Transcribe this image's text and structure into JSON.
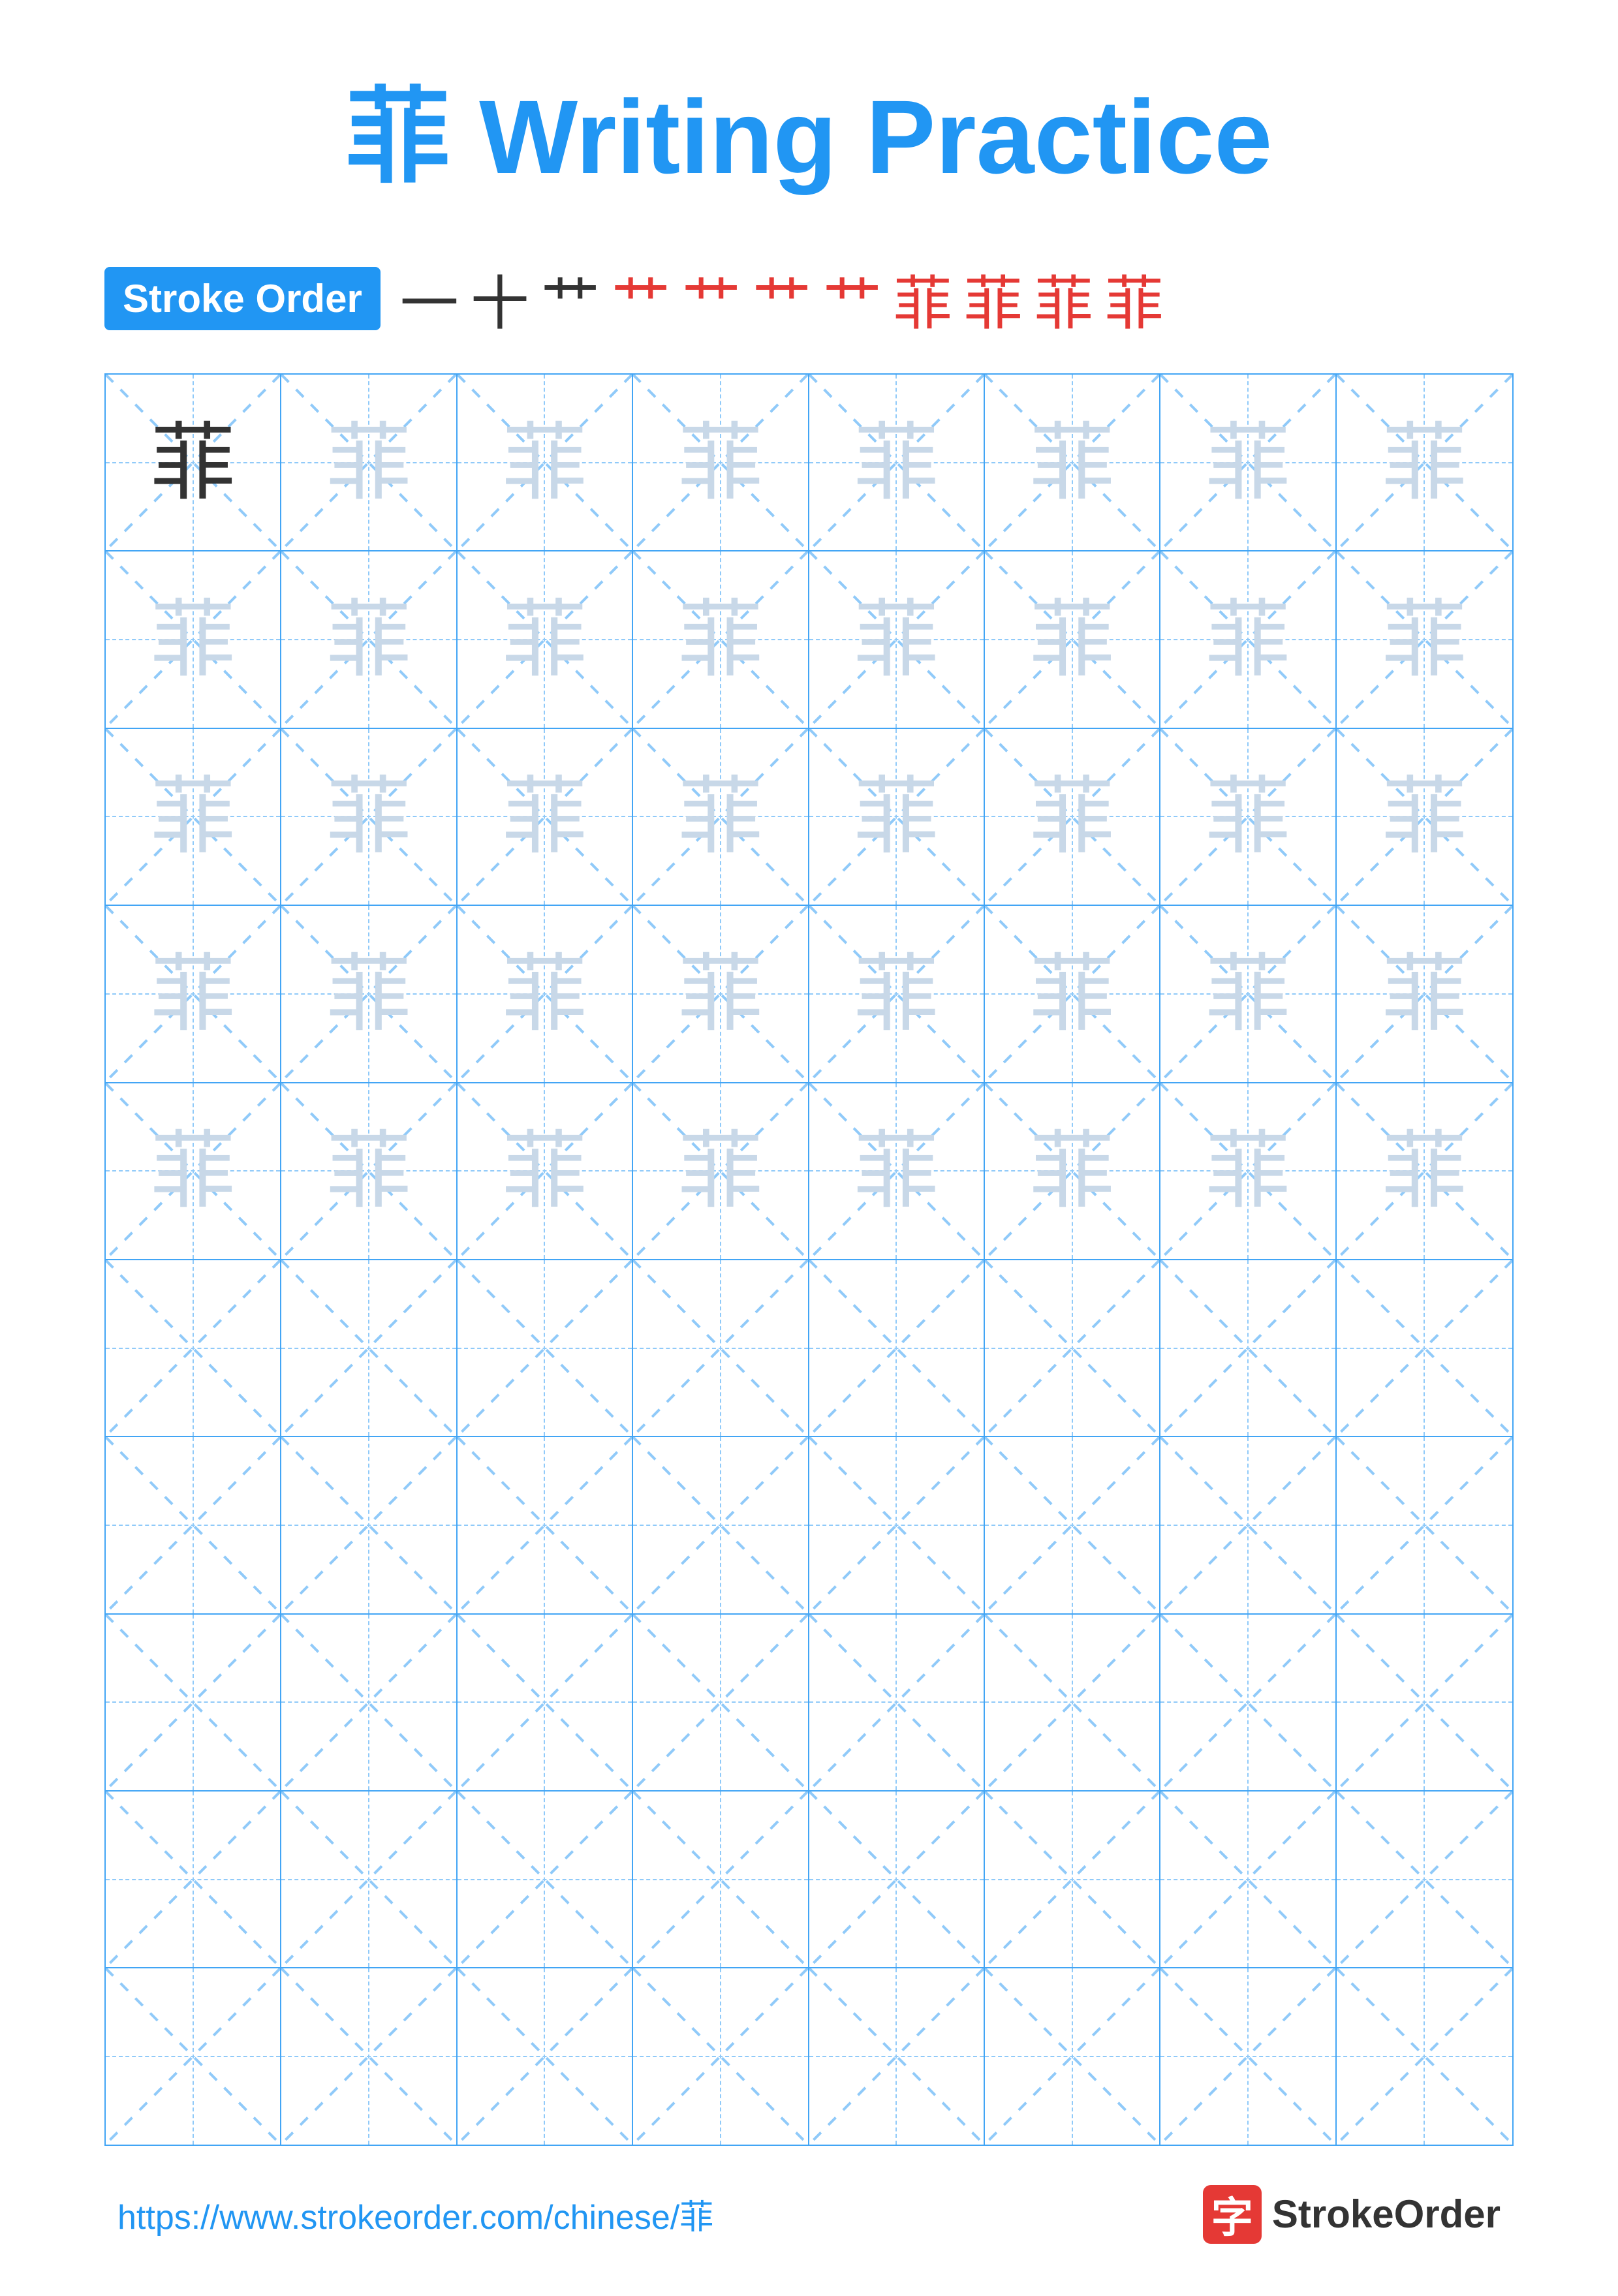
{
  "page": {
    "title": "菲 Writing Practice",
    "character": "菲",
    "stroke_order_label": "Stroke Order",
    "stroke_order_chars": [
      {
        "char": "一",
        "color": "black"
      },
      {
        "char": "十",
        "color": "black"
      },
      {
        "char": "艹",
        "color": "black"
      },
      {
        "char": "艹",
        "color": "red"
      },
      {
        "char": "艹",
        "color": "red"
      },
      {
        "char": "艹",
        "color": "red"
      },
      {
        "char": "艹",
        "color": "red"
      },
      {
        "char": "菲",
        "color": "red"
      },
      {
        "char": "菲",
        "color": "red"
      },
      {
        "char": "菲",
        "color": "red"
      },
      {
        "char": "菲",
        "color": "red"
      }
    ],
    "grid_rows": [
      [
        "dark",
        "light",
        "light",
        "light",
        "light",
        "light",
        "light",
        "light"
      ],
      [
        "light",
        "light",
        "light",
        "light",
        "light",
        "light",
        "light",
        "light"
      ],
      [
        "light",
        "light",
        "light",
        "light",
        "light",
        "light",
        "light",
        "light"
      ],
      [
        "light",
        "light",
        "light",
        "light",
        "light",
        "light",
        "light",
        "light"
      ],
      [
        "light",
        "light",
        "light",
        "light",
        "light",
        "light",
        "light",
        "light"
      ],
      [
        "empty",
        "empty",
        "empty",
        "empty",
        "empty",
        "empty",
        "empty",
        "empty"
      ],
      [
        "empty",
        "empty",
        "empty",
        "empty",
        "empty",
        "empty",
        "empty",
        "empty"
      ],
      [
        "empty",
        "empty",
        "empty",
        "empty",
        "empty",
        "empty",
        "empty",
        "empty"
      ],
      [
        "empty",
        "empty",
        "empty",
        "empty",
        "empty",
        "empty",
        "empty",
        "empty"
      ],
      [
        "empty",
        "empty",
        "empty",
        "empty",
        "empty",
        "empty",
        "empty",
        "empty"
      ]
    ],
    "footer": {
      "url": "https://www.strokeorder.com/chinese/菲",
      "logo_text": "StrokeOrder",
      "logo_char": "字"
    }
  }
}
